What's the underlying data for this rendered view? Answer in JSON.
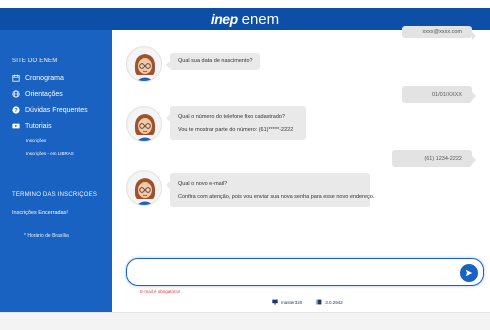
{
  "header": {
    "logo_inep": "inep",
    "logo_enem": "enem"
  },
  "sidebar": {
    "section_title": "SITE DO ENEM",
    "items": [
      {
        "label": "Cronograma",
        "icon": "calendar-icon"
      },
      {
        "label": "Orientações",
        "icon": "globe-icon"
      },
      {
        "label": "Dúvidas Frequentes",
        "icon": "help-icon"
      },
      {
        "label": "Tutoriais",
        "icon": "video-icon"
      }
    ],
    "sub_items": [
      "Inscrições",
      "Inscrições - em LIBRAS"
    ],
    "section2_title": "TÉRMINO DAS INSCRIÇÕES",
    "status_text": "Inscrições Encerradas!",
    "timezone_note": "* Horário de Brasília"
  },
  "chat": {
    "messages": [
      {
        "from": "user",
        "text": "xxxx@xxxx.com"
      },
      {
        "from": "bot",
        "lines": [
          "Qual sua data de nascimento?"
        ]
      },
      {
        "from": "user",
        "text": "01/01/XXXX"
      },
      {
        "from": "bot",
        "lines": [
          "Qual o número do telefone fixo cadastrado?",
          "Vou te mostrar parte do número: (61)*****-2222"
        ]
      },
      {
        "from": "user",
        "text": "(61) 1234-2222"
      },
      {
        "from": "bot",
        "lines": [
          "Qual o novo e-mail?",
          "Confira com atenção, pois vou enviar sua nova senha para esse novo endereço."
        ]
      }
    ],
    "input_value": "",
    "input_placeholder": "",
    "error_text": "E-mail é obrigatório!"
  },
  "footer": {
    "server": "master320",
    "version": "3.0.2942"
  },
  "colors": {
    "brand_blue": "#1a62c2",
    "header_blue": "#0d4ea6",
    "error_red": "#e53935"
  }
}
